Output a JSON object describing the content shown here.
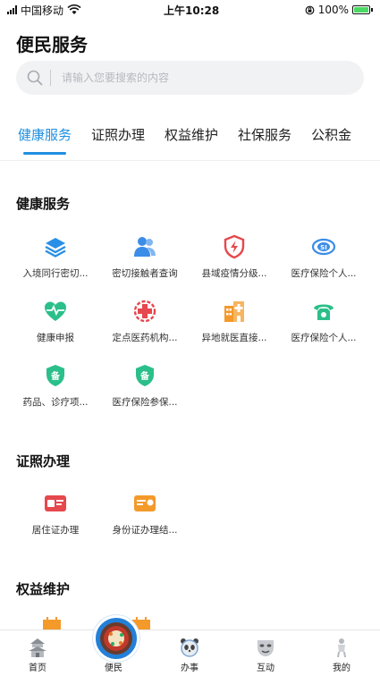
{
  "status_bar": {
    "carrier": "中国移动",
    "time": "上午10:28",
    "battery": "100%"
  },
  "header": {
    "title": "便民服务"
  },
  "search": {
    "placeholder": "请输入您要搜索的内容"
  },
  "tabs": [
    {
      "label": "健康服务",
      "active": true
    },
    {
      "label": "证照办理",
      "active": false
    },
    {
      "label": "权益维护",
      "active": false
    },
    {
      "label": "社保服务",
      "active": false
    },
    {
      "label": "公积金",
      "active": false
    }
  ],
  "sections": {
    "health": {
      "title": "健康服务",
      "items": [
        {
          "label": "入境同行密切...",
          "icon": "layers-icon"
        },
        {
          "label": "密切接触者查询",
          "icon": "people-icon"
        },
        {
          "label": "县域疫情分级...",
          "icon": "shield-bolt-icon"
        },
        {
          "label": "医疗保险个人...",
          "icon": "si-badge-icon"
        },
        {
          "label": "健康申报",
          "icon": "heart-pulse-icon"
        },
        {
          "label": "定点医药机构...",
          "icon": "medical-cross-icon"
        },
        {
          "label": "异地就医直接...",
          "icon": "hospital-icon"
        },
        {
          "label": "医疗保险个人...",
          "icon": "telephone-icon"
        },
        {
          "label": "药品、诊疗项...",
          "icon": "record-badge-icon"
        },
        {
          "label": "医疗保险参保...",
          "icon": "record-badge-icon"
        }
      ]
    },
    "license": {
      "title": "证照办理",
      "items": [
        {
          "label": "居住证办理",
          "icon": "residence-card-icon"
        },
        {
          "label": "身份证办理结...",
          "icon": "id-card-icon"
        }
      ]
    },
    "rights": {
      "title": "权益维护"
    }
  },
  "tabbar": [
    {
      "label": "首页",
      "icon": "pagoda-icon"
    },
    {
      "label": "便民",
      "icon": "hotpot-icon",
      "active": true
    },
    {
      "label": "办事",
      "icon": "panda-icon"
    },
    {
      "label": "互动",
      "icon": "opera-mask-icon"
    },
    {
      "label": "我的",
      "icon": "figure-icon"
    }
  ],
  "colors": {
    "accent": "#1f8fe0",
    "green": "#2bbf8a",
    "orange": "#f39a2b",
    "red": "#e5484d",
    "blue": "#3b8de8"
  }
}
